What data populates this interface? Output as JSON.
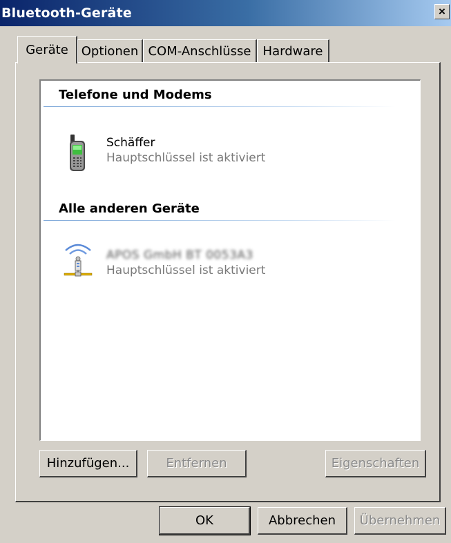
{
  "window": {
    "title": "Bluetooth-Geräte",
    "close_label": "×"
  },
  "tabs": [
    {
      "label": "Geräte",
      "active": true
    },
    {
      "label": "Optionen",
      "active": false
    },
    {
      "label": "COM-Anschlüsse",
      "active": false
    },
    {
      "label": "Hardware",
      "active": false
    }
  ],
  "device_groups": [
    {
      "header": "Telefone und Modems",
      "devices": [
        {
          "name": "Schäffer",
          "status": "Hauptschlüssel ist aktiviert",
          "icon": "mobile-phone-icon",
          "name_obscured": false
        }
      ]
    },
    {
      "header": "Alle anderen Geräte",
      "devices": [
        {
          "name": "APOS GmbH BT 0053A3",
          "status": "Hauptschlüssel ist aktiviert",
          "icon": "bluetooth-network-icon",
          "name_obscured": true
        }
      ]
    }
  ],
  "panel_buttons": {
    "add": "Hinzufügen...",
    "remove": "Entfernen",
    "properties": "Eigenschaften"
  },
  "dialog_buttons": {
    "ok": "OK",
    "cancel": "Abbrechen",
    "apply": "Übernehmen"
  },
  "colors": {
    "title_bar_start": "#0a246a",
    "title_bar_end": "#a6caf0",
    "dialog_face": "#d4d0c8",
    "disabled_text": "#8a8a8a"
  }
}
